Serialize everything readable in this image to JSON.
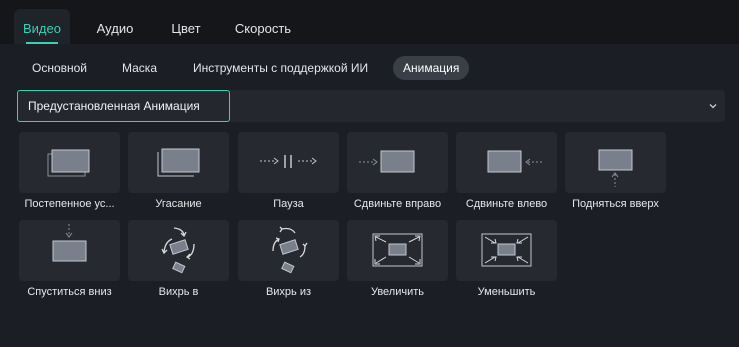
{
  "tabs": [
    {
      "label": "Видео",
      "active": true
    },
    {
      "label": "Аудио",
      "active": false
    },
    {
      "label": "Цвет",
      "active": false
    },
    {
      "label": "Скорость",
      "active": false
    }
  ],
  "subtabs": [
    {
      "label": "Основной",
      "active": false
    },
    {
      "label": "Маска",
      "active": false
    },
    {
      "label": "Инструменты с поддержкой ИИ",
      "active": false
    },
    {
      "label": "Анимация",
      "active": true
    }
  ],
  "preset": {
    "value": "Предустановленная Анимация"
  },
  "animations": [
    {
      "label": "Постепенное ус...",
      "icon": "fade-in-icon"
    },
    {
      "label": "Угасание",
      "icon": "fade-out-icon"
    },
    {
      "label": "Пауза",
      "icon": "pause-icon"
    },
    {
      "label": "Сдвиньте вправо",
      "icon": "slide-right-icon"
    },
    {
      "label": "Сдвиньте влево",
      "icon": "slide-left-icon"
    },
    {
      "label": "Подняться вверх",
      "icon": "rise-up-icon"
    },
    {
      "label": "Спуститься вниз",
      "icon": "drop-down-icon"
    },
    {
      "label": "Вихрь в",
      "icon": "swirl-in-icon"
    },
    {
      "label": "Вихрь из",
      "icon": "swirl-out-icon"
    },
    {
      "label": "Увеличить",
      "icon": "zoom-in-icon"
    },
    {
      "label": "Уменьшить",
      "icon": "zoom-out-icon"
    }
  ],
  "colors": {
    "accent": "#38d1b2",
    "panel": "#1b1e24",
    "tile": "#26292f"
  }
}
